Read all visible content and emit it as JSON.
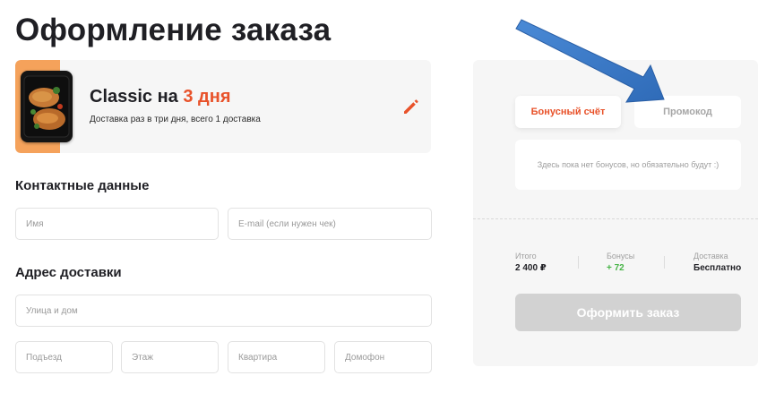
{
  "page": {
    "title": "Оформление заказа"
  },
  "product": {
    "name": "Classic на",
    "duration": "3 дня",
    "description": "Доставка раз в три дня, всего 1 доставка",
    "edit_icon": "pencil-icon"
  },
  "contact": {
    "title": "Контактные данные",
    "name_placeholder": "Имя",
    "email_placeholder": "E-mail (если нужен чек)"
  },
  "address": {
    "title": "Адрес доставки",
    "street_placeholder": "Улица и дом",
    "entrance_placeholder": "Подъезд",
    "floor_placeholder": "Этаж",
    "apartment_placeholder": "Квартира",
    "intercom_placeholder": "Домофон"
  },
  "sidebar": {
    "tabs": [
      {
        "label": "Бонусный счёт",
        "active": true
      },
      {
        "label": "Промокод",
        "active": false
      }
    ],
    "bonus_empty_text": "Здесь пока нет бонусов, но обязательно будут :)",
    "summary": {
      "total_label": "Итого",
      "total_value": "2 400 ₽",
      "bonus_label": "Бонусы",
      "bonus_value": "+ 72",
      "delivery_label": "Доставка",
      "delivery_value": "Бесплатно"
    },
    "submit_label": "Оформить заказ"
  },
  "colors": {
    "accent": "#e8522a",
    "bonus_green": "#47b447",
    "annotation_arrow": "#3a7bc8",
    "disabled_button": "#d2d2d2"
  }
}
